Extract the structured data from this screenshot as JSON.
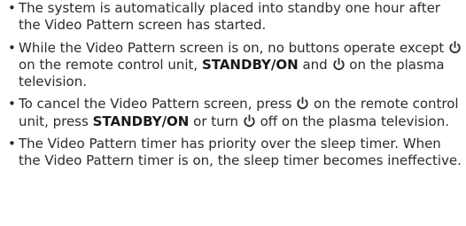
{
  "bullet_symbol": "•",
  "power_icon": "power-standby-icon",
  "notes": [
    {
      "text": "The system is automatically placed into standby one hour after the Video Pattern screen has started."
    },
    {
      "text_1": "While the Video Pattern screen is on, no buttons operate except",
      "text_2": "on the remote control unit,",
      "bold_1": "STANDBY/ON",
      "text_3": "and",
      "text_4": "on the plasma television."
    },
    {
      "text_1": "To cancel the Video Pattern screen, press",
      "text_2": "on the remote control unit, press",
      "bold_1": "STANDBY/ON",
      "text_3": "or turn",
      "text_4": "off on the plasma television."
    },
    {
      "text": "The Video Pattern timer has priority over the sleep timer. When the Video Pattern timer is on, the sleep timer becomes ineffective."
    }
  ]
}
